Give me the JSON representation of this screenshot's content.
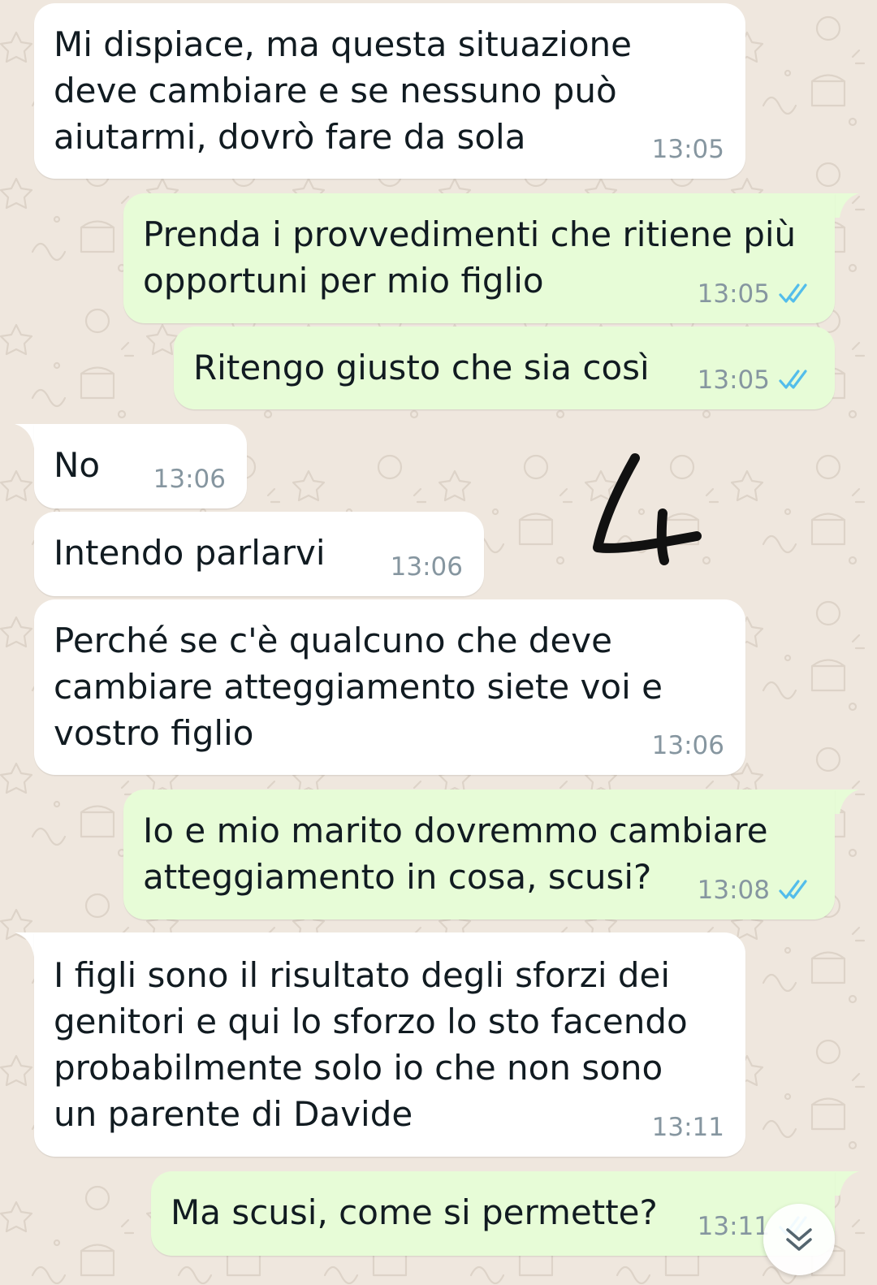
{
  "colors": {
    "wallpaper": "#efe7de",
    "incoming_bubble": "#ffffff",
    "outgoing_bubble": "#e7fcd7",
    "timestamp": "#8696a0",
    "read_ticks": "#53bdeb",
    "text": "#111b21"
  },
  "messages": [
    {
      "direction": "in",
      "text": "Mi dispiace, ma questa situazione\ndeve cambiare e se nessuno può\naiutarmi, dovrò fare da sola",
      "time": "13:05"
    },
    {
      "direction": "out",
      "text": "Prenda i provvedimenti che ritiene più\nopportuni per mio figlio",
      "time": "13:05",
      "status": "read"
    },
    {
      "direction": "out",
      "text": "Ritengo giusto che sia così",
      "time": "13:05",
      "status": "read"
    },
    {
      "direction": "in",
      "text": "No",
      "time": "13:06"
    },
    {
      "direction": "in",
      "text": "Intendo parlarvi",
      "time": "13:06"
    },
    {
      "direction": "in",
      "text": "Perché se c'è qualcuno che deve\ncambiare atteggiamento siete voi e\nvostro figlio",
      "time": "13:06"
    },
    {
      "direction": "out",
      "text": "Io e mio marito dovremmo cambiare\natteggiamento in cosa, scusi?",
      "time": "13:08",
      "status": "read"
    },
    {
      "direction": "in",
      "text": "I figli sono il risultato degli sforzi dei\ngenitori e qui lo sforzo lo sto facendo\nprobabilmente solo io che non sono\nun parente di Davide",
      "time": "13:11"
    },
    {
      "direction": "out",
      "text": "Ma scusi, come si permette?",
      "time": "13:11",
      "status": "read"
    }
  ],
  "handwritten_annotation": "4",
  "scroll_button": {
    "icon": "double-chevron-down-icon"
  }
}
